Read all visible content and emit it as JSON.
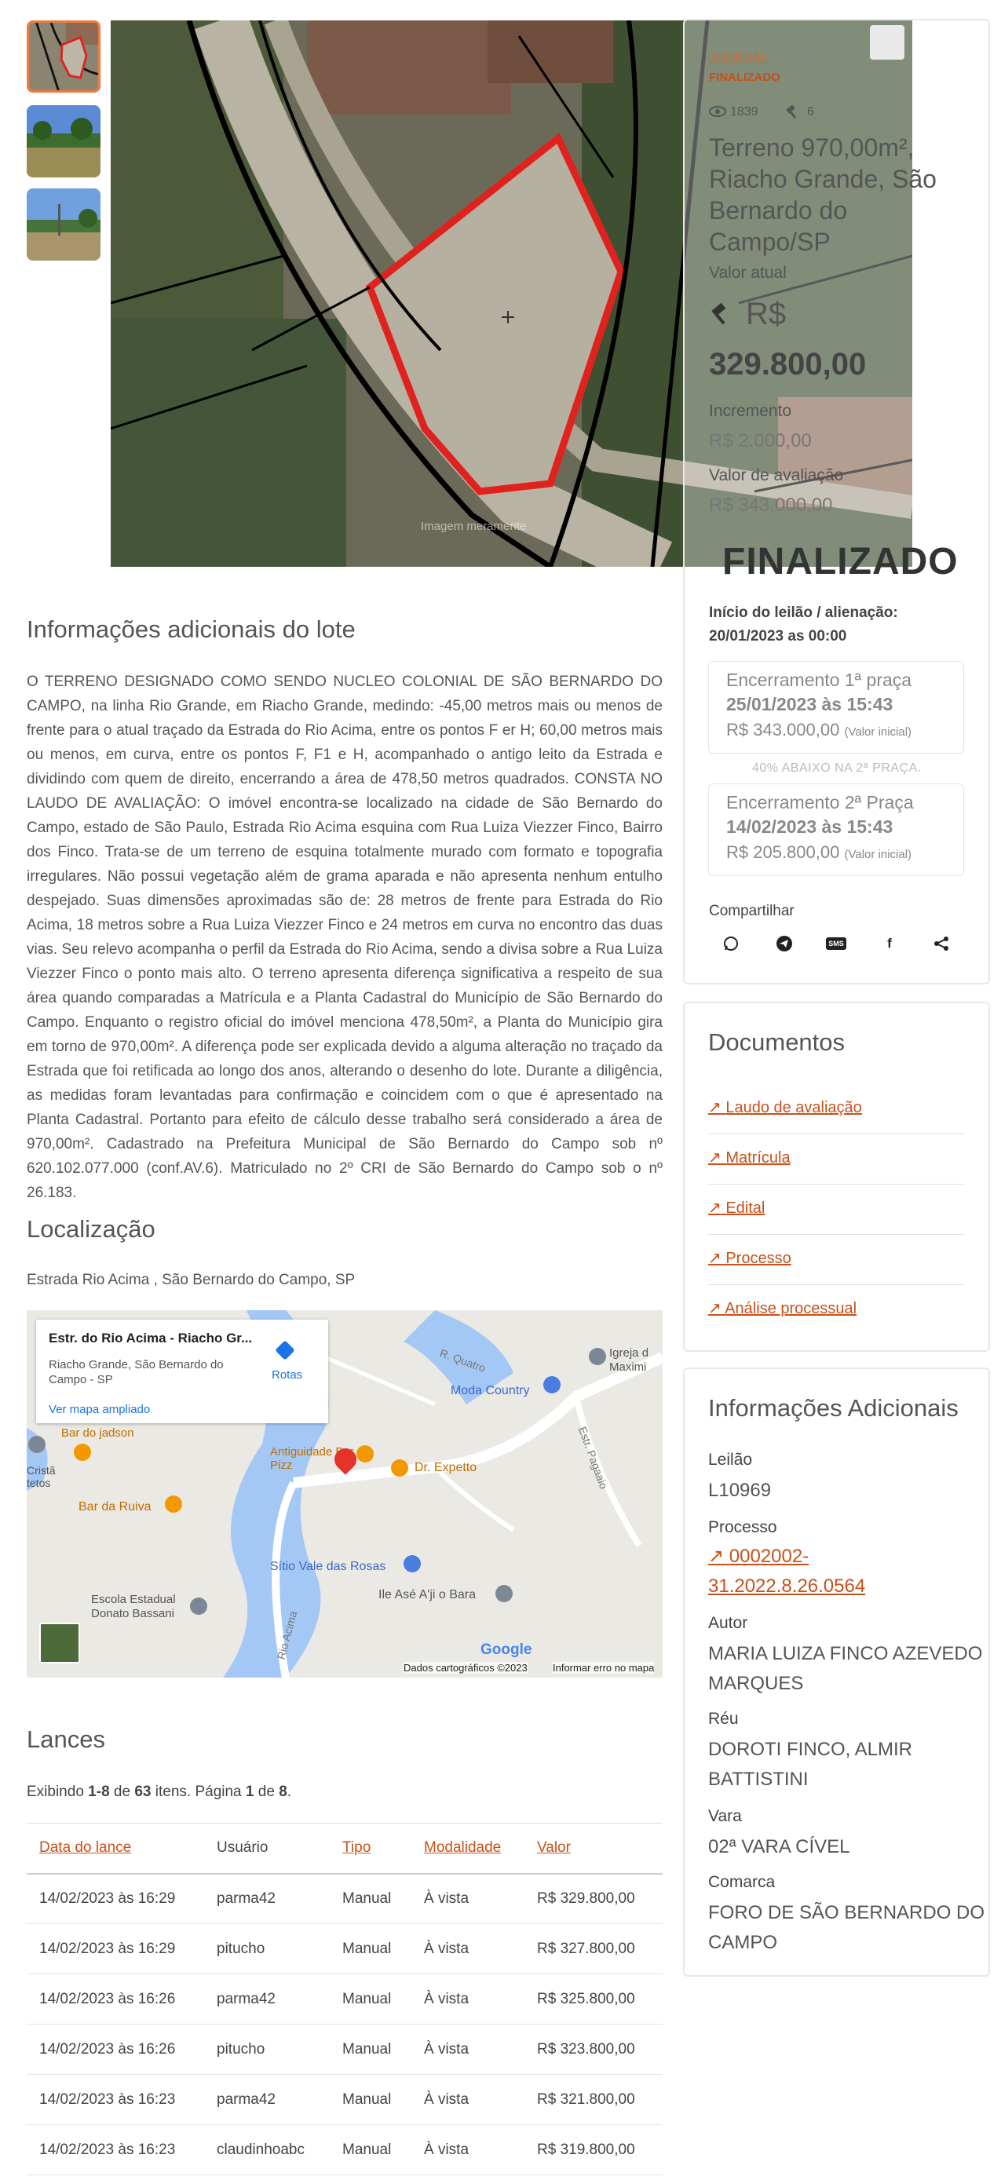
{
  "gallery": {
    "thumbs": [
      "thumb-aerial",
      "thumb-field",
      "thumb-field-2"
    ]
  },
  "photo": {
    "watermark": "Imagem meramente"
  },
  "header": {
    "tag": "JUDICIAL",
    "lot_code": "20219",
    "status": "FINALIZADO",
    "views": "1839",
    "hammer_count": "6",
    "lot_title": "Terreno 970,00m², Riacho Grande, São Bernardo do Campo/SP",
    "valor_atual_label": "Valor atual",
    "valor_atual_prefix": "R$",
    "valor_atual": "329.800,00",
    "incremento_label": "Incremento",
    "incremento": "R$ 2.000,00",
    "avaliacao_label": "Valor de avaliação",
    "avaliacao": "R$ 343.000,00",
    "finalizado_banner": "FINALIZADO"
  },
  "auction": {
    "inicio_label": "Início do leilão / alienação:",
    "inicio": "20/01/2023 as 00:00",
    "praca1_title": "Encerramento 1ª praça",
    "praca1_date": "25/01/2023 às 15:43",
    "praca1_value": "R$ 343.000,00",
    "praca1_note": "(Valor inicial)",
    "discount_note": "40% ABAIXO NA 2ª PRAÇA.",
    "praca2_title": "Encerramento 2ª Praça",
    "praca2_date": "14/02/2023 às 15:43",
    "praca2_value": "R$ 205.800,00",
    "praca2_note": "(Valor inicial)",
    "share_label": "Compartilhar",
    "share_icons": [
      "whatsapp-icon",
      "telegram-icon",
      "sms-icon",
      "facebook-icon",
      "share-icon"
    ],
    "sms_text": "SMS",
    "fb_text": "f"
  },
  "info_section": {
    "title": "Informações adicionais do lote",
    "description": "O TERRENO DESIGNADO COMO SENDO NUCLEO COLONIAL DE SÃO BERNARDO DO CAMPO, na linha Rio Grande, em Riacho Grande, medindo: -45,00 metros mais ou menos de frente para o atual traçado da Estrada do Rio Acima, entre os pontos F er H; 60,00 metros mais ou menos, em curva, entre os pontos F, F1 e H, acompanhado o antigo leito da Estrada e dividindo com quem de direito, encerrando a área de 478,50 metros quadrados. CONSTA NO LAUDO DE AVALIAÇÃO: O imóvel encontra-se localizado na cidade de São Bernardo do Campo, estado de São Paulo, Estrada Rio Acima esquina com Rua Luiza Viezzer Finco, Bairro dos Finco. Trata-se de um terreno de esquina totalmente murado com formato e topografia irregulares. Não possui vegetação além de grama aparada e não apresenta nenhum entulho despejado. Suas dimensões aproximadas são de: 28 metros de frente para Estrada do Rio Acima, 18 metros sobre a Rua Luiza Viezzer Finco e 24 metros em curva no encontro das duas vias. Seu relevo acompanha o perfil da Estrada do Rio Acima, sendo a divisa sobre a Rua Luiza Viezzer Finco o ponto mais alto. O terreno apresenta diferença significativa a respeito de sua área quando comparadas a Matrícula e a Planta Cadastral do Município de São Bernardo do Campo. Enquanto o registro oficial do imóvel menciona 478,50m², a Planta do Município gira em torno de 970,00m². A diferença pode ser explicada devido a alguma alteração no traçado da Estrada que foi retificada ao longo dos anos, alterando o desenho do lote. Durante a diligência, as medidas foram levantadas para confirmação e coincidem com o que é apresentado na Planta Cadastral. Portanto para efeito de cálculo desse trabalho será considerado a área de 970,00m². Cadastrado na Prefeitura Municipal de São Bernardo do Campo sob nº 620.102.077.000 (conf.AV.6). Matriculado no 2º CRI de São Bernardo do Campo sob o nº 26.183."
  },
  "location": {
    "title": "Localização",
    "address": "Estrada Rio Acima , São Bernardo do Campo, SP"
  },
  "map": {
    "popup_title": "Estr. do Rio Acima - Riacho Gr...",
    "popup_address": "Riacho Grande, São Bernardo do Campo - SP",
    "popup_routes": "Rotas",
    "popup_link": "Ver mapa ampliado",
    "labels": {
      "r_quatro": "R. Quatro",
      "igreja": "Igreja d Maximi",
      "moda_country": "Moda Country",
      "estr_pagaaio": "Estr. Pagaaio",
      "bar_jadson": "Bar do jadson",
      "crista": "Cristã tetos",
      "antiguidades": "Antiguidade Bar e Pizz",
      "dr_expetto": "Dr. Expetto",
      "bar_ruiva": "Bar da Ruiva",
      "sitio": "Sítio Vale das Rosas",
      "ile": "Ile Asé A'ji o Bara",
      "escola": "Escola Estadual Donato Bassani",
      "rio_acima": "Rio Acima",
      "google": "Google",
      "dados": "Dados cartográficos ©2023",
      "informar": "Informar erro no mapa"
    }
  },
  "lances": {
    "title": "Lances",
    "summary_prefix": "Exibindo ",
    "summary_range": "1-8",
    "summary_mid": " de ",
    "summary_total": "63",
    "summary_mid2": " itens. Página ",
    "summary_page": "1",
    "summary_mid3": " de ",
    "summary_pages": "8",
    "summary_end": ".",
    "headers": [
      "Data do lance",
      "Usuário",
      "Tipo",
      "Modalidade",
      "Valor"
    ],
    "rows": [
      [
        "14/02/2023 às 16:29",
        "parma42",
        "Manual",
        "À vista",
        "R$ 329.800,00"
      ],
      [
        "14/02/2023 às 16:29",
        "pitucho",
        "Manual",
        "À vista",
        "R$ 327.800,00"
      ],
      [
        "14/02/2023 às 16:26",
        "parma42",
        "Manual",
        "À vista",
        "R$ 325.800,00"
      ],
      [
        "14/02/2023 às 16:26",
        "pitucho",
        "Manual",
        "À vista",
        "R$ 323.800,00"
      ],
      [
        "14/02/2023 às 16:23",
        "parma42",
        "Manual",
        "À vista",
        "R$ 321.800,00"
      ],
      [
        "14/02/2023 às 16:23",
        "claudinhoabc",
        "Manual",
        "À vista",
        "R$ 319.800,00"
      ]
    ]
  },
  "documentos": {
    "title": "Documentos",
    "items": [
      "Laudo de avaliação",
      "Matrícula",
      "Edital",
      "Processo",
      "Análise processual"
    ]
  },
  "adicionais": {
    "title": "Informações Adicionais",
    "leilao_label": "Leilão",
    "leilao": "L10969",
    "processo_label": "Processo",
    "processo": "0002002-31.2022.8.26.0564",
    "autor_label": "Autor",
    "autor": "MARIA LUIZA FINCO AZEVEDO MARQUES",
    "reu_label": "Réu",
    "reu": "DOROTI FINCO, ALMIR BATTISTINI",
    "vara_label": "Vara",
    "vara": "02ª VARA CÍVEL",
    "comarca_label": "Comarca",
    "comarca": "FORO DE SÃO BERNARDO DO CAMPO"
  },
  "colors": {
    "accent": "#c9501a",
    "thumb_border": "#f07b3f",
    "lot_outline": "#e0221e"
  }
}
